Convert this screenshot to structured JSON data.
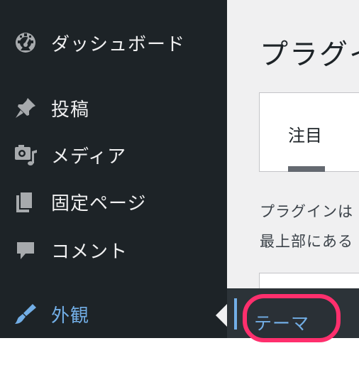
{
  "sidebar": {
    "items": [
      {
        "icon": "dashboard-icon",
        "label": "ダッシュボード"
      },
      {
        "icon": "pin-icon",
        "label": "投稿"
      },
      {
        "icon": "media-icon",
        "label": "メディア"
      },
      {
        "icon": "pages-icon",
        "label": "固定ページ"
      },
      {
        "icon": "comment-icon",
        "label": "コメント"
      },
      {
        "icon": "paintbrush-icon",
        "label": "外観",
        "active": true
      }
    ]
  },
  "submenu": {
    "label": "テーマ"
  },
  "main": {
    "title": "プラグイ",
    "tab_label": "注目",
    "description_lines": [
      "プラグインは",
      "最上部にある"
    ]
  },
  "colors": {
    "sidebar_bg": "#1d2327",
    "text_light": "#f0f0f1",
    "accent_blue": "#72aee6",
    "highlight": "#ff2f6d",
    "content_bg": "#f0f0f1"
  }
}
